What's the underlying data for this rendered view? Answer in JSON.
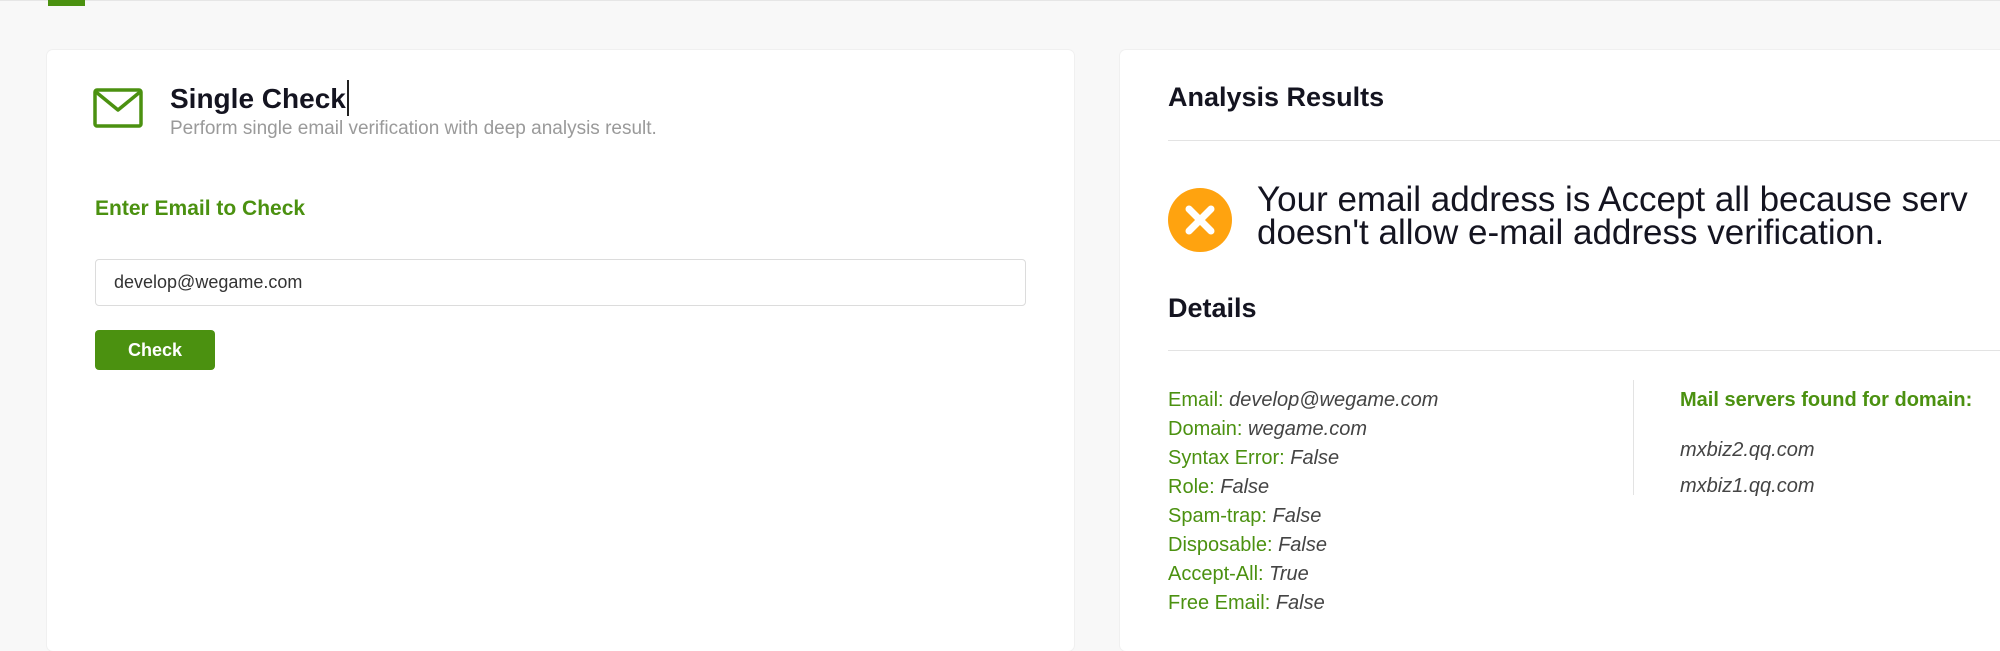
{
  "single_check": {
    "title": "Single Check",
    "subtitle": "Perform single email verification with deep analysis result.",
    "icon": "envelope-icon",
    "enter_label": "Enter Email to Check",
    "email_value": "develop@wegame.com",
    "check_button": "Check"
  },
  "results": {
    "title": "Analysis Results",
    "status_icon": "x-circle-icon",
    "status_line1": "Your email address is Accept all because serv",
    "status_line2": "doesn't allow e-mail address verification.",
    "details_title": "Details",
    "details": [
      {
        "key": "Email:",
        "value": "develop@wegame.com"
      },
      {
        "key": "Domain:",
        "value": "wegame.com"
      },
      {
        "key": "Syntax Error:",
        "value": "False"
      },
      {
        "key": "Role:",
        "value": "False"
      },
      {
        "key": "Spam-trap:",
        "value": "False"
      },
      {
        "key": "Disposable:",
        "value": "False"
      },
      {
        "key": "Accept-All:",
        "value": "True"
      },
      {
        "key": "Free Email:",
        "value": "False"
      }
    ],
    "mail_servers_title": "Mail servers found for domain:",
    "mail_servers": [
      "mxbiz2.qq.com",
      "mxbiz1.qq.com"
    ]
  },
  "colors": {
    "accent": "#4b9110",
    "warning": "#ffa30f",
    "text": "#141420"
  }
}
